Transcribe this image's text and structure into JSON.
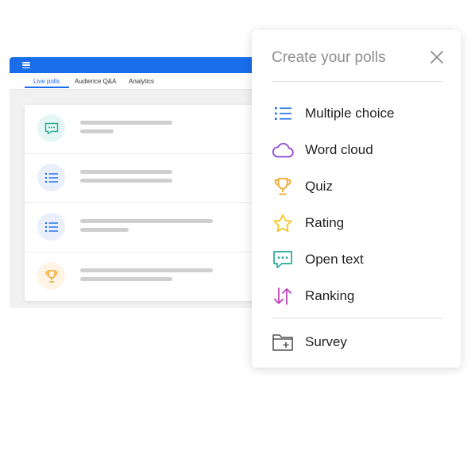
{
  "app": {
    "tabs": [
      {
        "label": "Live polls",
        "active": true
      },
      {
        "label": "Audience Q&A",
        "active": false
      },
      {
        "label": "Analytics",
        "active": false
      }
    ],
    "accent_color": "#196cea",
    "poll_rows": [
      {
        "icon": "speech-bubble-icon",
        "color": "#25a898"
      },
      {
        "icon": "list-icon",
        "color": "#196cea"
      },
      {
        "icon": "list-icon",
        "color": "#196cea"
      },
      {
        "icon": "trophy-icon",
        "color": "#f0a52a"
      }
    ]
  },
  "panel": {
    "title": "Create your polls",
    "close_icon": "close-icon",
    "items": [
      {
        "label": "Multiple choice",
        "icon": "list-icon",
        "color": "#196cea"
      },
      {
        "label": "Word cloud",
        "icon": "cloud-icon",
        "color": "#8a3fd1"
      },
      {
        "label": "Quiz",
        "icon": "trophy-icon",
        "color": "#f0a52a"
      },
      {
        "label": "Rating",
        "icon": "star-icon",
        "color": "#f5c518"
      },
      {
        "label": "Open text",
        "icon": "speech-bubble-icon",
        "color": "#25a898"
      },
      {
        "label": "Ranking",
        "icon": "ranking-arrows-icon",
        "color": "#c23bbf"
      }
    ],
    "extra_item": {
      "label": "Survey",
      "icon": "folder-plus-icon",
      "color": "#555555"
    }
  }
}
